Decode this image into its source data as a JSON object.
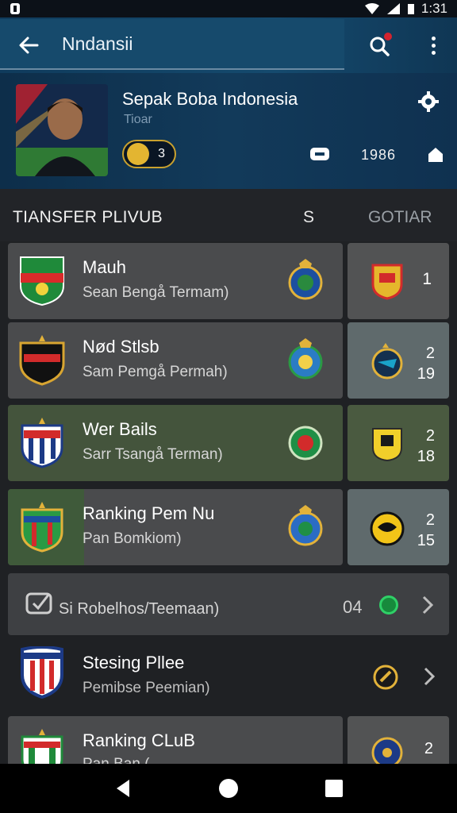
{
  "status_bar": {
    "time": "1:31"
  },
  "app_bar": {
    "title": "Nndansii"
  },
  "profile": {
    "name": "Sepak Boba Indonesia",
    "subtitle": "Tioar",
    "badge_count": "3",
    "stat_value": "1986"
  },
  "section": {
    "title": "TIANSFER PLIVUB",
    "col_s": "S",
    "col_right": "GOTIAR"
  },
  "rows": [
    {
      "title": "Mauh",
      "subtitle": "Sean Bengå Termam)",
      "side_value": "1",
      "side_sub": ""
    },
    {
      "title": "Nød Stlsb",
      "subtitle": "Sam Pemgå Permah)",
      "side_value": "2",
      "side_sub": "19"
    },
    {
      "title": "Wer Bails",
      "subtitle": "Sarr Tsangå Terman)",
      "side_value": "2",
      "side_sub": "18"
    },
    {
      "title": "Ranking Pem Nu",
      "subtitle": "Pan Bomkiom)",
      "side_value": "2",
      "side_sub": "15"
    }
  ],
  "wide_row": {
    "label": "Si Robelhos/Teemaan)",
    "count": "04"
  },
  "plain_row": {
    "title": "Stesing Pllee",
    "subtitle": "Pemibse Peemian)"
  },
  "last_row": {
    "title": "Ranking CLuB",
    "subtitle": "Pan Ban (",
    "side_value": "2"
  },
  "colors": {
    "appbar": "#154a6e",
    "profile_bg": "#123a5a",
    "card": "#4a4b4d",
    "card_green": "#44543c",
    "accent_gold": "#e3b531"
  },
  "icons": [
    "back-arrow-icon",
    "search-icon",
    "more-vert-icon",
    "gear-icon",
    "chat-icon",
    "home-icon",
    "chevron-right-icon",
    "check-box-icon",
    "nav-back-icon",
    "nav-home-icon",
    "nav-recents-icon"
  ]
}
